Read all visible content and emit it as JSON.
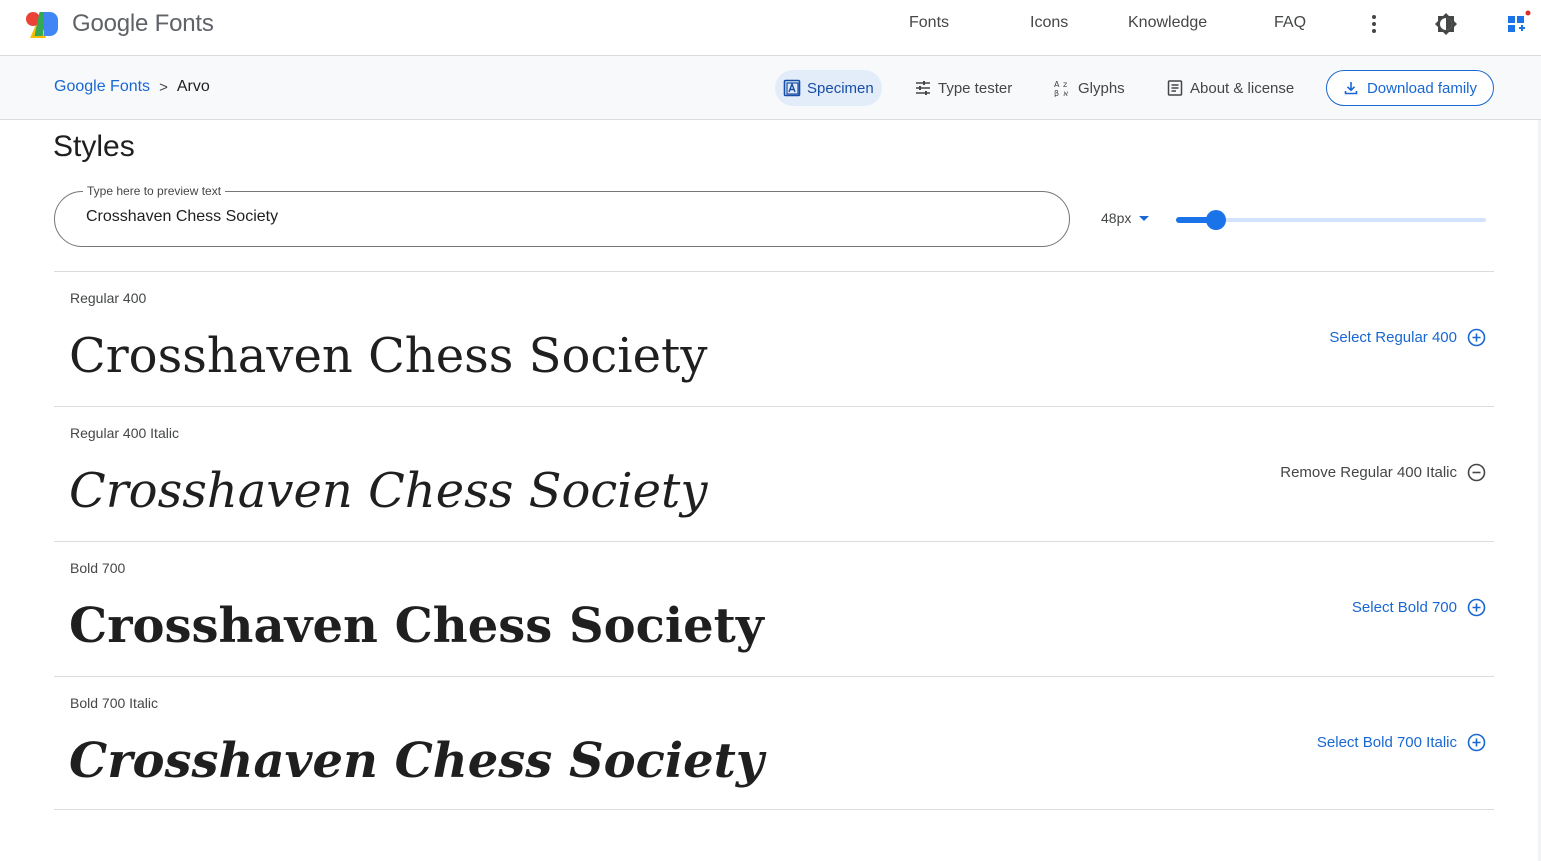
{
  "header": {
    "logo_text": "Google Fonts",
    "nav": [
      "Fonts",
      "Icons",
      "Knowledge",
      "FAQ"
    ],
    "icons": [
      "more-vert-icon",
      "theme-toggle-icon",
      "selected-families-icon"
    ]
  },
  "subheader": {
    "breadcrumb_root": "Google Fonts",
    "breadcrumb_sep": ">",
    "breadcrumb_current": "Arvo",
    "tabs": [
      "Specimen",
      "Type tester",
      "Glyphs",
      "About & license"
    ],
    "active_tab": "Specimen",
    "download_label": "Download family"
  },
  "styles": {
    "title": "Styles",
    "preview_label": "Type here to preview text",
    "preview_value": "Crosshaven Chess Society",
    "size_value": "48px",
    "slider_fraction": 0.13,
    "rows": [
      {
        "label": "Regular 400",
        "sample": "Crosshaven Chess Society",
        "action": "Select Regular 400",
        "action_type": "select"
      },
      {
        "label": "Regular 400 Italic",
        "sample": "Crosshaven Chess Society",
        "action": "Remove Regular 400 Italic",
        "action_type": "remove"
      },
      {
        "label": "Bold 700",
        "sample": "Crosshaven Chess Society",
        "action": "Select Bold 700",
        "action_type": "select"
      },
      {
        "label": "Bold 700 Italic",
        "sample": "Crosshaven Chess Society",
        "action": "Select Bold 700 Italic",
        "action_type": "select"
      }
    ]
  },
  "colors": {
    "accent": "#1967d2",
    "active_tab_bg": "#e3ecf9",
    "notification_dot": "#d93025"
  }
}
